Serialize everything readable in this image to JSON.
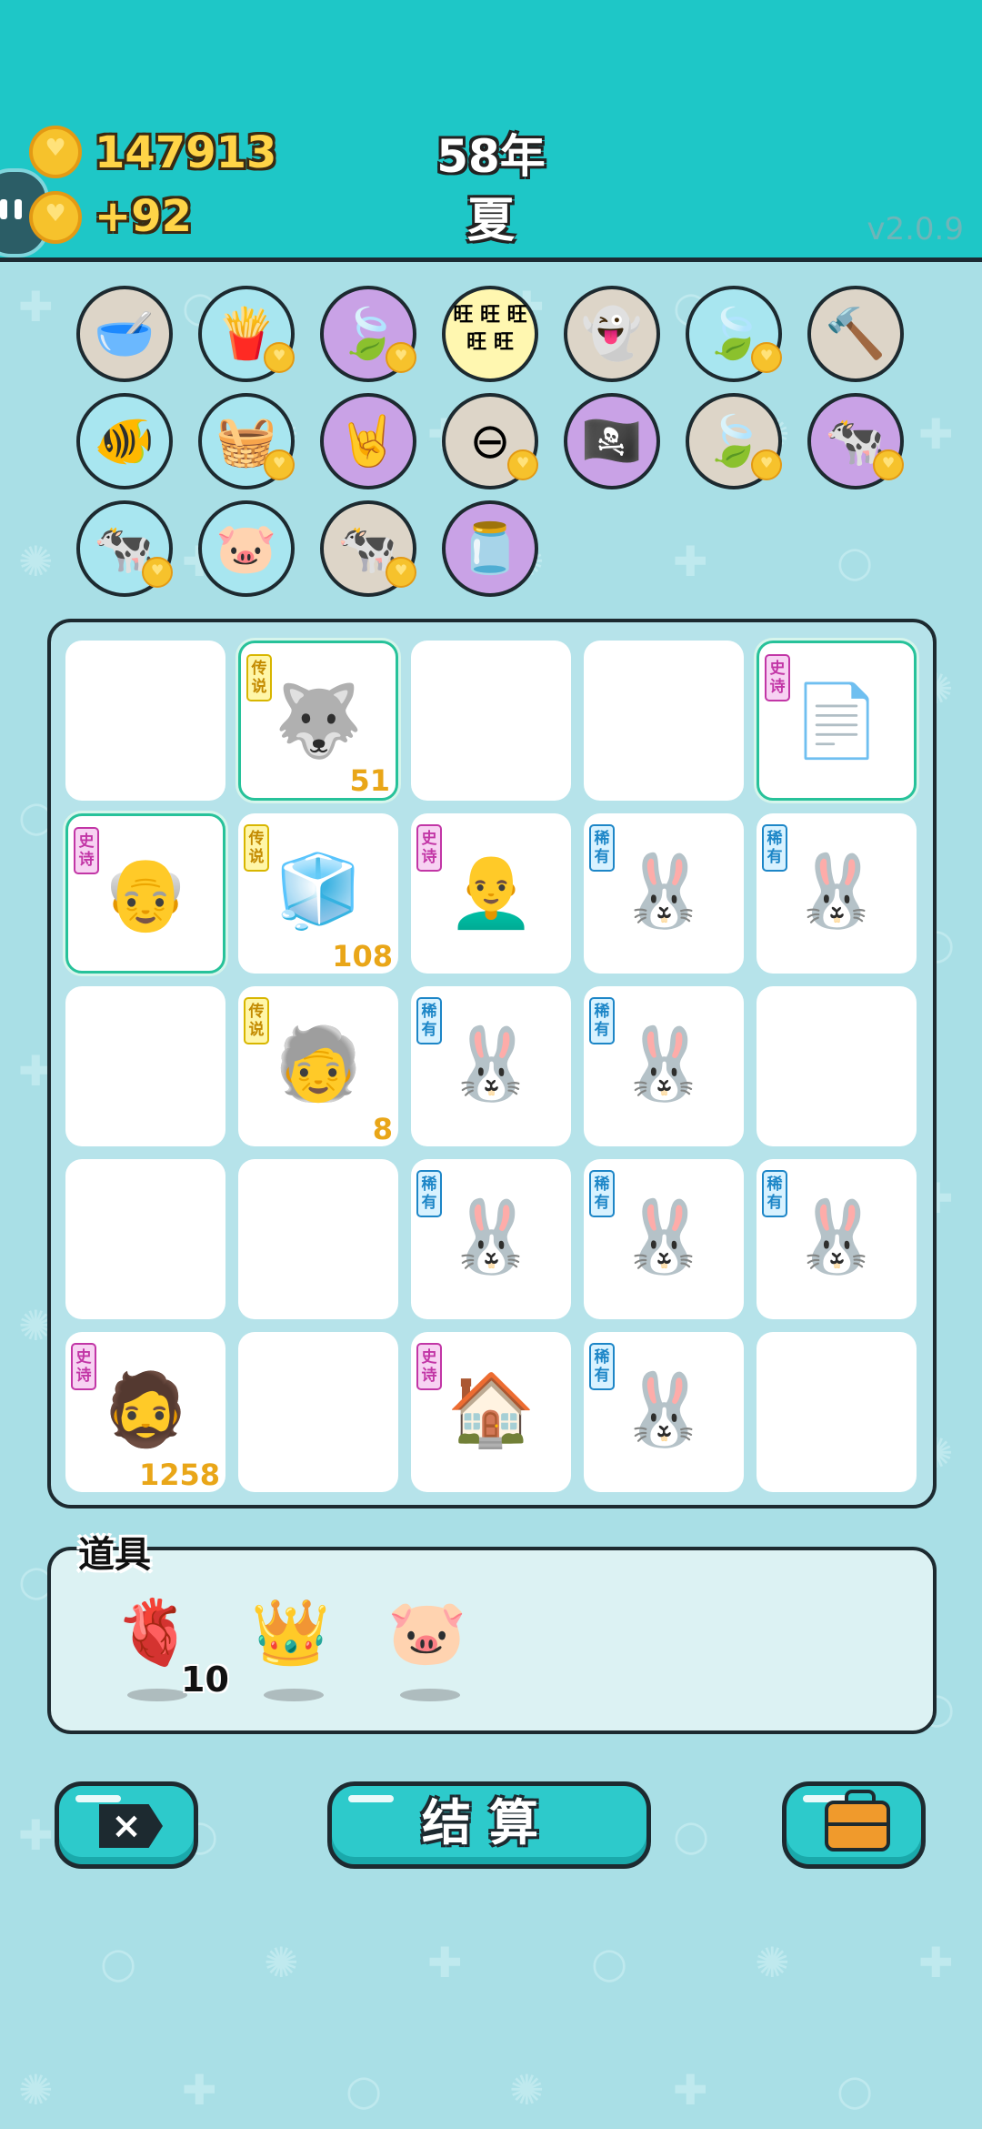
{
  "header": {
    "coins": "147913",
    "coin_gain": "+92",
    "year": "58年",
    "season": "夏",
    "version": "v2.0.9"
  },
  "items": [
    {
      "name": "pet-food-bowl-icon",
      "glyph": "🥣",
      "bg": "tan",
      "bonus": false
    },
    {
      "name": "french-fries-icon",
      "glyph": "🍟",
      "bg": "blue",
      "bonus": true
    },
    {
      "name": "leaf-icon",
      "glyph": "🍃",
      "bg": "purple",
      "bonus": true
    },
    {
      "name": "wang-icon",
      "glyph": "",
      "bg": "yellow",
      "bonus": false,
      "text": "旺 旺 旺 旺 旺"
    },
    {
      "name": "ghost-icon",
      "glyph": "👻",
      "bg": "tan",
      "bonus": false
    },
    {
      "name": "leaf-icon",
      "glyph": "🍃",
      "bg": "blue",
      "bonus": true
    },
    {
      "name": "hammer-icon",
      "glyph": "🔨",
      "bg": "tan",
      "bonus": false
    },
    {
      "name": "fish-tank-icon",
      "glyph": "🐠",
      "bg": "blue",
      "bonus": false
    },
    {
      "name": "fruit-basket-icon",
      "glyph": "🧺",
      "bg": "blue",
      "bonus": true
    },
    {
      "name": "rock-hand-icon",
      "glyph": "🤘",
      "bg": "purple",
      "bonus": false
    },
    {
      "name": "minus-icon",
      "glyph": "⊖",
      "bg": "tan",
      "bonus": true
    },
    {
      "name": "eye-patch-icon",
      "glyph": "🏴‍☠️",
      "bg": "purple",
      "bonus": false
    },
    {
      "name": "leaf-icon",
      "glyph": "🍃",
      "bg": "tan",
      "bonus": true
    },
    {
      "name": "cow-pair-icon",
      "glyph": "🐄",
      "bg": "purple",
      "bonus": true
    },
    {
      "name": "cow-pair-icon",
      "glyph": "🐄",
      "bg": "blue",
      "bonus": true
    },
    {
      "name": "piggy-bank-icon",
      "glyph": "🐷",
      "bg": "blue",
      "bonus": false
    },
    {
      "name": "cow-pair-icon",
      "glyph": "🐄",
      "bg": "tan",
      "bonus": true
    },
    {
      "name": "jar-icon",
      "glyph": "🫙",
      "bg": "purple",
      "bonus": false
    }
  ],
  "board": [
    {
      "name": "empty-cell",
      "tag": "",
      "tagType": "",
      "glyph": "",
      "count": "",
      "hl": false
    },
    {
      "name": "husky-king-icon",
      "tag": "传说",
      "tagType": "legend",
      "glyph": "🐺",
      "count": "51",
      "hl": true
    },
    {
      "name": "empty-cell",
      "tag": "",
      "tagType": "",
      "glyph": "",
      "count": "",
      "hl": false
    },
    {
      "name": "empty-cell",
      "tag": "",
      "tagType": "",
      "glyph": "",
      "count": "",
      "hl": false
    },
    {
      "name": "copy-paste-icon",
      "tag": "史诗",
      "tagType": "epic",
      "glyph": "📄",
      "count": "",
      "hl": true
    },
    {
      "name": "old-farmer-icon",
      "tag": "史诗",
      "tagType": "epic",
      "glyph": "👴",
      "count": "",
      "hl": true
    },
    {
      "name": "fridge-icon",
      "tag": "传说",
      "tagType": "legend",
      "glyph": "🧊",
      "count": "108",
      "hl": false
    },
    {
      "name": "bald-grandpa-icon",
      "tag": "史诗",
      "tagType": "epic",
      "glyph": "👨‍🦲",
      "count": "",
      "hl": false
    },
    {
      "name": "rabbit-icon",
      "tag": "稀有",
      "tagType": "rare",
      "glyph": "🐰",
      "count": "",
      "hl": false
    },
    {
      "name": "rabbit-icon",
      "tag": "稀有",
      "tagType": "rare",
      "glyph": "🐰",
      "count": "",
      "hl": false
    },
    {
      "name": "empty-cell",
      "tag": "",
      "tagType": "",
      "glyph": "",
      "count": "",
      "hl": false
    },
    {
      "name": "rich-grandpa-icon",
      "tag": "传说",
      "tagType": "legend",
      "glyph": "🧓",
      "count": "8",
      "hl": false
    },
    {
      "name": "rabbit-icon",
      "tag": "稀有",
      "tagType": "rare",
      "glyph": "🐰",
      "count": "",
      "hl": false
    },
    {
      "name": "rabbit-icon",
      "tag": "稀有",
      "tagType": "rare",
      "glyph": "🐰",
      "count": "",
      "hl": false
    },
    {
      "name": "empty-cell",
      "tag": "",
      "tagType": "",
      "glyph": "",
      "count": "",
      "hl": false
    },
    {
      "name": "empty-cell",
      "tag": "",
      "tagType": "",
      "glyph": "",
      "count": "",
      "hl": false
    },
    {
      "name": "empty-cell",
      "tag": "",
      "tagType": "",
      "glyph": "",
      "count": "",
      "hl": false
    },
    {
      "name": "rabbit-icon",
      "tag": "稀有",
      "tagType": "rare",
      "glyph": "🐰",
      "count": "",
      "hl": false
    },
    {
      "name": "rabbit-icon",
      "tag": "稀有",
      "tagType": "rare",
      "glyph": "🐰",
      "count": "",
      "hl": false
    },
    {
      "name": "rabbit-icon",
      "tag": "稀有",
      "tagType": "rare",
      "glyph": "🐰",
      "count": "",
      "hl": false
    },
    {
      "name": "bearded-man-icon",
      "tag": "史诗",
      "tagType": "epic",
      "glyph": "🧔",
      "count": "1258",
      "hl": false
    },
    {
      "name": "empty-cell",
      "tag": "",
      "tagType": "",
      "glyph": "",
      "count": "",
      "hl": false
    },
    {
      "name": "rabbit-house-icon",
      "tag": "史诗",
      "tagType": "epic",
      "glyph": "🏠",
      "count": "",
      "hl": false
    },
    {
      "name": "rabbit-icon",
      "tag": "稀有",
      "tagType": "rare",
      "glyph": "🐰",
      "count": "",
      "hl": false
    },
    {
      "name": "empty-cell",
      "tag": "",
      "tagType": "",
      "glyph": "",
      "count": "",
      "hl": false
    }
  ],
  "tools": {
    "title": "道具",
    "items": [
      {
        "name": "liver-icon",
        "glyph": "🫀",
        "count": "10"
      },
      {
        "name": "crown-icon",
        "glyph": "👑",
        "count": ""
      },
      {
        "name": "piggy-bank-icon",
        "glyph": "🐷",
        "count": ""
      }
    ]
  },
  "buttons": {
    "exit_icon": "×",
    "settle_label": "结算"
  },
  "colors": {
    "header": "#1ec7c7",
    "background": "#a9dfe6",
    "coin_text": "#ffd447",
    "accent_button": "#2dcacb"
  }
}
